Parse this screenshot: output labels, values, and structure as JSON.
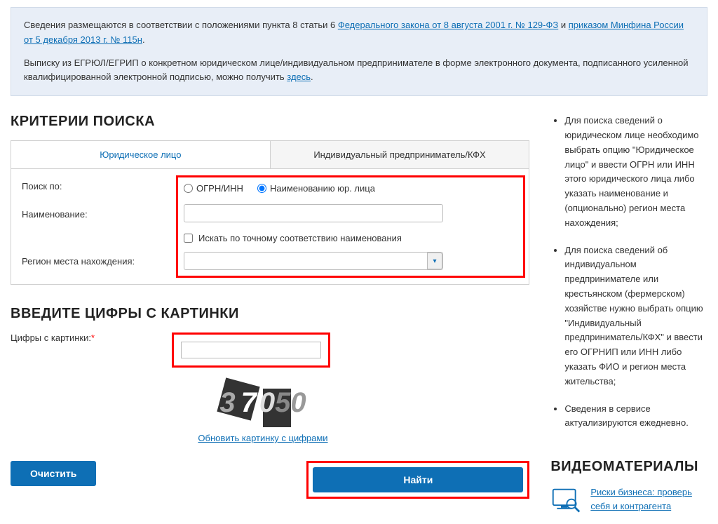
{
  "info": {
    "text1a": "Сведения размещаются в соответствии с положениями пункта 8 статьи 6 ",
    "link1": "Федерального закона от 8 августа 2001 г. № 129-ФЗ",
    "text1b": " и ",
    "link2": "приказом Минфина России от 5 декабря 2013 г. № 115н",
    "text1c": ".",
    "text2a": "Выписку из ЕГРЮЛ/ЕГРИП о конкретном юридическом лице/индивидуальном предпринимателе в форме электронного документа, подписанного усиленной квалифицированной электронной подписью, можно получить ",
    "link3": "здесь",
    "text2b": "."
  },
  "search": {
    "heading": "КРИТЕРИИ ПОИСКА",
    "tab_legal": "Юридическое лицо",
    "tab_ip": "Индивидуальный предприниматель/КФХ",
    "label_searchby": "Поиск по:",
    "radio_ogrn": "ОГРН/ИНН",
    "radio_name": "Наименованию юр. лица",
    "label_name": "Наименование:",
    "checkbox_exact": "Искать по точному соответствию наименования",
    "label_region": "Регион места нахождения:"
  },
  "captcha": {
    "heading": "ВВЕДИТЕ ЦИФРЫ С КАРТИНКИ",
    "label": "Цифры с картинки:",
    "required": "*",
    "refresh_link": "Обновить картинку с цифрами",
    "digits": "37050"
  },
  "buttons": {
    "clear": "Очистить",
    "find": "Найти"
  },
  "help": {
    "item1": "Для поиска сведений о юридическом лице необходимо выбрать опцию \"Юридическое лицо\" и ввести ОГРН или ИНН этого юридического лица либо указать наименование и (опционально) регион места нахождения;",
    "item2": "Для поиска сведений об индивидуальном предпринимателе или крестьянском (фермерском) хозяйстве нужно выбрать опцию \"Индивидуальный предприниматель/КФХ\" и ввести его ОГРНИП или ИНН либо указать ФИО и регион места жительства;",
    "item3": "Сведения в сервисе актуализируются ежедневно."
  },
  "video": {
    "heading": "ВИДЕОМАТЕРИАЛЫ",
    "link1": "Риски бизнеса: проверь себя и контрагента"
  }
}
